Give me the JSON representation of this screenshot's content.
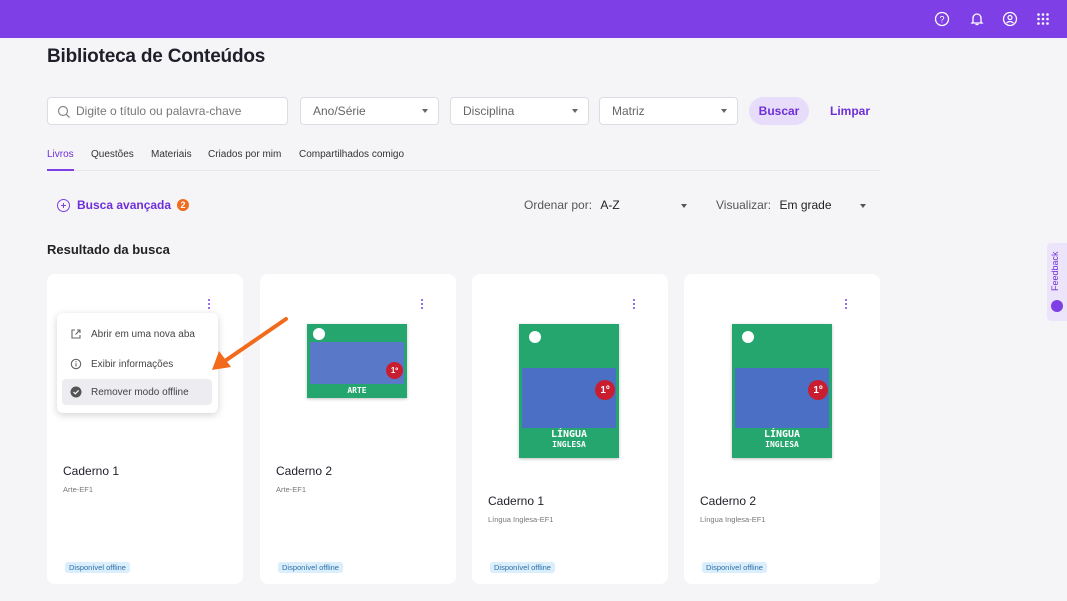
{
  "header": {
    "icons": [
      "help-circle-icon",
      "bell-icon",
      "user-circle-icon",
      "apps-grid-icon"
    ],
    "background": "#7e3fe6"
  },
  "page": {
    "title": "Biblioteca de Conteúdos"
  },
  "filters": {
    "search_placeholder": "Digite o título ou palavra-chave",
    "grade": "Ano/Série",
    "subject": "Disciplina",
    "matrix": "Matriz",
    "search_button": "Buscar",
    "clear_button": "Limpar"
  },
  "tabs": [
    "Livros",
    "Questões",
    "Materiais",
    "Criados por mim",
    "Compartilhados comigo"
  ],
  "toolbar": {
    "advanced_search": "Busca avançada",
    "advanced_count": "2",
    "sort_label": "Ordenar por:",
    "sort_value": "A-Z",
    "view_label": "Visualizar:",
    "view_value": "Em grade"
  },
  "results_title": "Resultado da busca",
  "cards": [
    {
      "title": "Caderno 1",
      "subtitle": "Arte-EF1",
      "badge": "Disponível offline"
    },
    {
      "title": "Caderno 2",
      "subtitle": "Arte-EF1",
      "badge": "Disponível offline",
      "book_title": "ARTE",
      "book_grade": "1º"
    },
    {
      "title": "Caderno 1",
      "subtitle": "Língua Inglesa-EF1",
      "badge": "Disponível offline",
      "book_title_1": "LÍNGUA",
      "book_title_2": "INGLESA",
      "book_grade": "1º"
    },
    {
      "title": "Caderno 2",
      "subtitle": "Língua Inglesa-EF1",
      "badge": "Disponível offline",
      "book_title_1": "LÍNGUA",
      "book_title_2": "INGLESA",
      "book_grade": "1º"
    }
  ],
  "context_menu": {
    "items": [
      {
        "label": "Abrir em uma nova aba",
        "icon": "external-link-icon"
      },
      {
        "label": "Exibir informações",
        "icon": "info-icon"
      },
      {
        "label": "Remover modo offline",
        "icon": "check-circle-icon"
      }
    ]
  },
  "feedback_label": "Feedback",
  "colors": {
    "accent": "#7e3fe6",
    "annotation_arrow": "#f26b1d",
    "book_green": "#26a66f"
  }
}
